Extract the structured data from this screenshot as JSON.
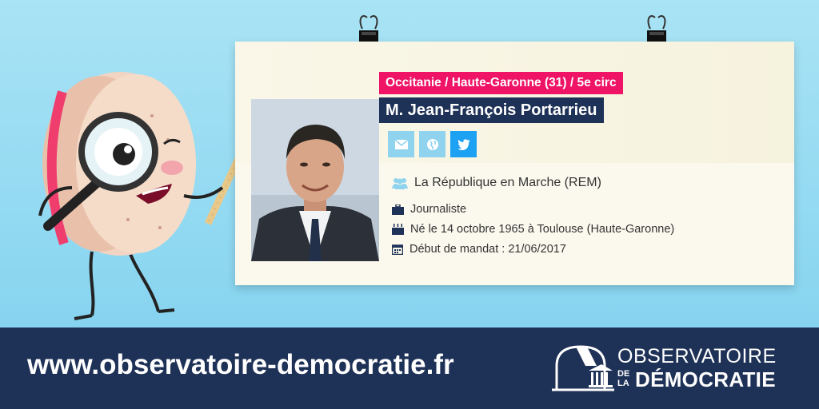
{
  "card": {
    "region": "Occitanie / Haute-Garonne (31) / 5e circ",
    "name": "M. Jean-François Portarrieu",
    "social": [
      {
        "icon": "envelope-icon"
      },
      {
        "icon": "globe-icon"
      },
      {
        "icon": "twitter-icon"
      }
    ],
    "party": "La République en Marche (REM)",
    "profession": "Journaliste",
    "birth": "Né le 14 octobre 1965 à Toulouse (Haute-Garonne)",
    "mandate_start": "Début de mandat : 21/06/2017"
  },
  "footer": {
    "url": "www.observatoire-democratie.fr",
    "logo": {
      "line1": "OBSERVATOIRE",
      "prefix_de": "DE",
      "prefix_la": "LA",
      "line2": "DÉMOCRATIE"
    }
  },
  "colors": {
    "background": "#8fd8f1",
    "region_badge": "#ef1466",
    "name_badge": "#1e3156",
    "footer": "#1e3156",
    "social_light": "#8fd3ee",
    "twitter": "#1da1f2",
    "card": "#fbf9ee"
  }
}
